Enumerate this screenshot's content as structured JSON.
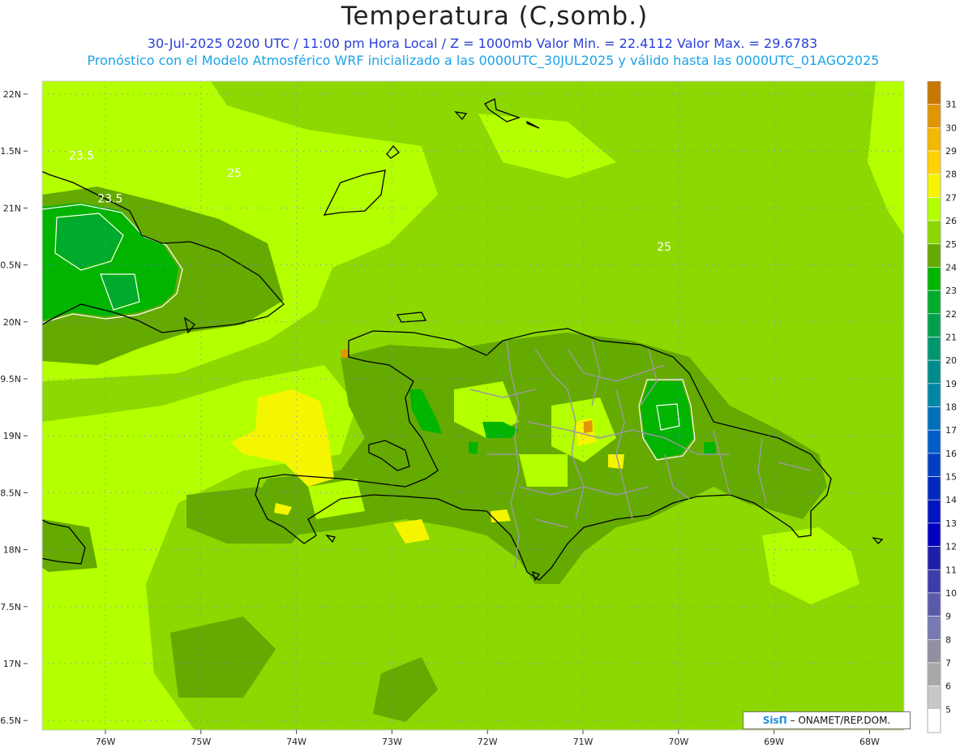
{
  "header": {
    "title": "Temperatura (C,somb.)",
    "subtitle_line1": "30-Jul-2025  0200 UTC / 11:00 pm Hora Local / Z = 1000mb   Valor Min. = 22.4112  Valor Max. = 29.6783",
    "subtitle_line2": "Pronóstico con el Modelo Atmosférico WRF inicializado a las 0000UTC_30JUL2025 y válido hasta las  0000UTC_01AGO2025"
  },
  "axes": {
    "lat_labels": [
      "22N",
      "1.5N",
      "21N",
      "0.5N",
      "20N",
      "9.5N",
      "19N",
      "8.5N",
      "18N",
      "7.5N",
      "17N",
      "6.5N"
    ],
    "lon_labels": [
      "76W",
      "75W",
      "74W",
      "73W",
      "72W",
      "71W",
      "70W",
      "69W",
      "68W"
    ]
  },
  "contour_labels": [
    {
      "text": "23.5",
      "lon": -76.25,
      "lat": 20.85
    },
    {
      "text": "25",
      "lon": -74.65,
      "lat": 20.55
    },
    {
      "text": "23.5",
      "lon": -75.95,
      "lat": 20.1
    },
    {
      "text": "25",
      "lon": -70.15,
      "lat": 19.25
    }
  ],
  "colorbar": {
    "labels": [
      "31",
      "30",
      "29",
      "28",
      "27",
      "26",
      "25",
      "24",
      "23",
      "22",
      "21",
      "20",
      "19",
      "18",
      "17",
      "16",
      "15",
      "14",
      "13",
      "12",
      "11",
      "10",
      "9",
      "8",
      "7",
      "6",
      "5"
    ],
    "colors": [
      "#c87800",
      "#e09600",
      "#f5b800",
      "#ffd200",
      "#f5f500",
      "#b4ff00",
      "#8cd800",
      "#64aa00",
      "#00b400",
      "#00aa2d",
      "#00a04b",
      "#00966e",
      "#008c8c",
      "#0086a5",
      "#0070bb",
      "#005cc8",
      "#0040c0",
      "#0028c0",
      "#0014c0",
      "#0000c0",
      "#1e1eaa",
      "#3c3caa",
      "#5a5aaa",
      "#7878b4",
      "#9090a0",
      "#a8a8a8",
      "#c8c8c8",
      "#ffffff"
    ]
  },
  "credit": {
    "brand": "SisΠ",
    "text": "– ONAMET/REP.DOM."
  },
  "colors": {
    "field_light": "#b4ff00",
    "field_mid": "#8cd800",
    "field_dark": "#64aa00",
    "field_green": "#00b400",
    "field_yellow": "#ffff00",
    "coast": "#000000",
    "provinces": "#9a9a9a",
    "grid": "#7c7cff"
  }
}
